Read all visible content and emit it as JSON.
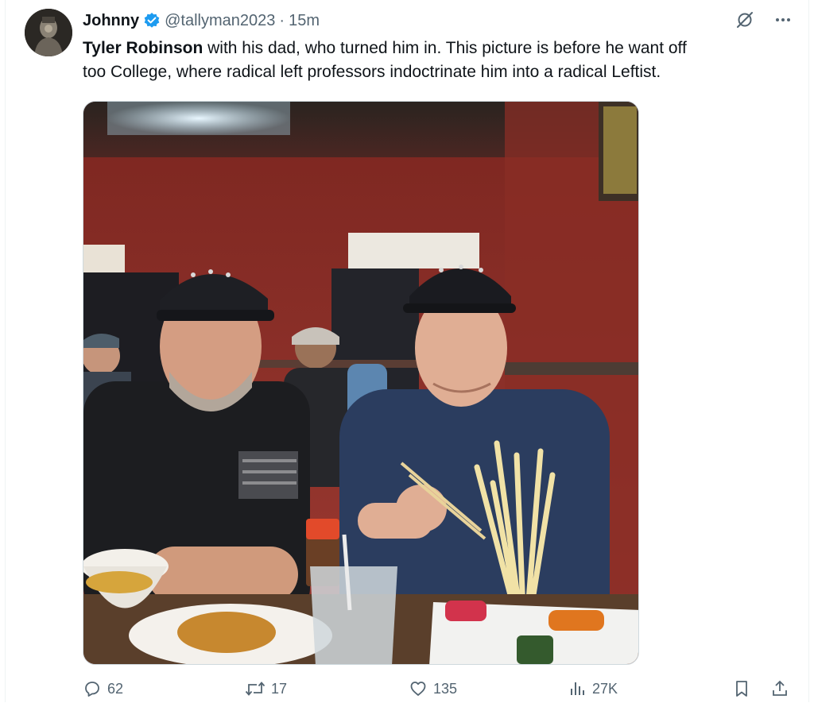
{
  "post": {
    "author": {
      "name": "Johnny",
      "handle": "@tallyman2023",
      "separator": "·",
      "time": "15m"
    },
    "text": {
      "bold": "Tyler Robinson",
      "line1": " with his dad, who turned him in.  This picture is before he want off",
      "line2": "too College,  where radical left professors  indoctrinate him into a radical Leftist."
    },
    "media": {
      "type": "photo",
      "icon": "photo"
    },
    "stats": {
      "replies": "62",
      "reposts": "17",
      "likes": "135",
      "views": "27K"
    }
  },
  "icons": {
    "verified": "verified-badge-icon",
    "grok": "grok-icon",
    "more": "more-icon",
    "reply": "reply-icon",
    "repost": "repost-icon",
    "like": "heart-icon",
    "views": "views-icon",
    "bookmark": "bookmark-icon",
    "share": "share-icon"
  },
  "colors": {
    "accent": "#1d9bf0",
    "muted": "#536471",
    "text": "#0f1419"
  }
}
